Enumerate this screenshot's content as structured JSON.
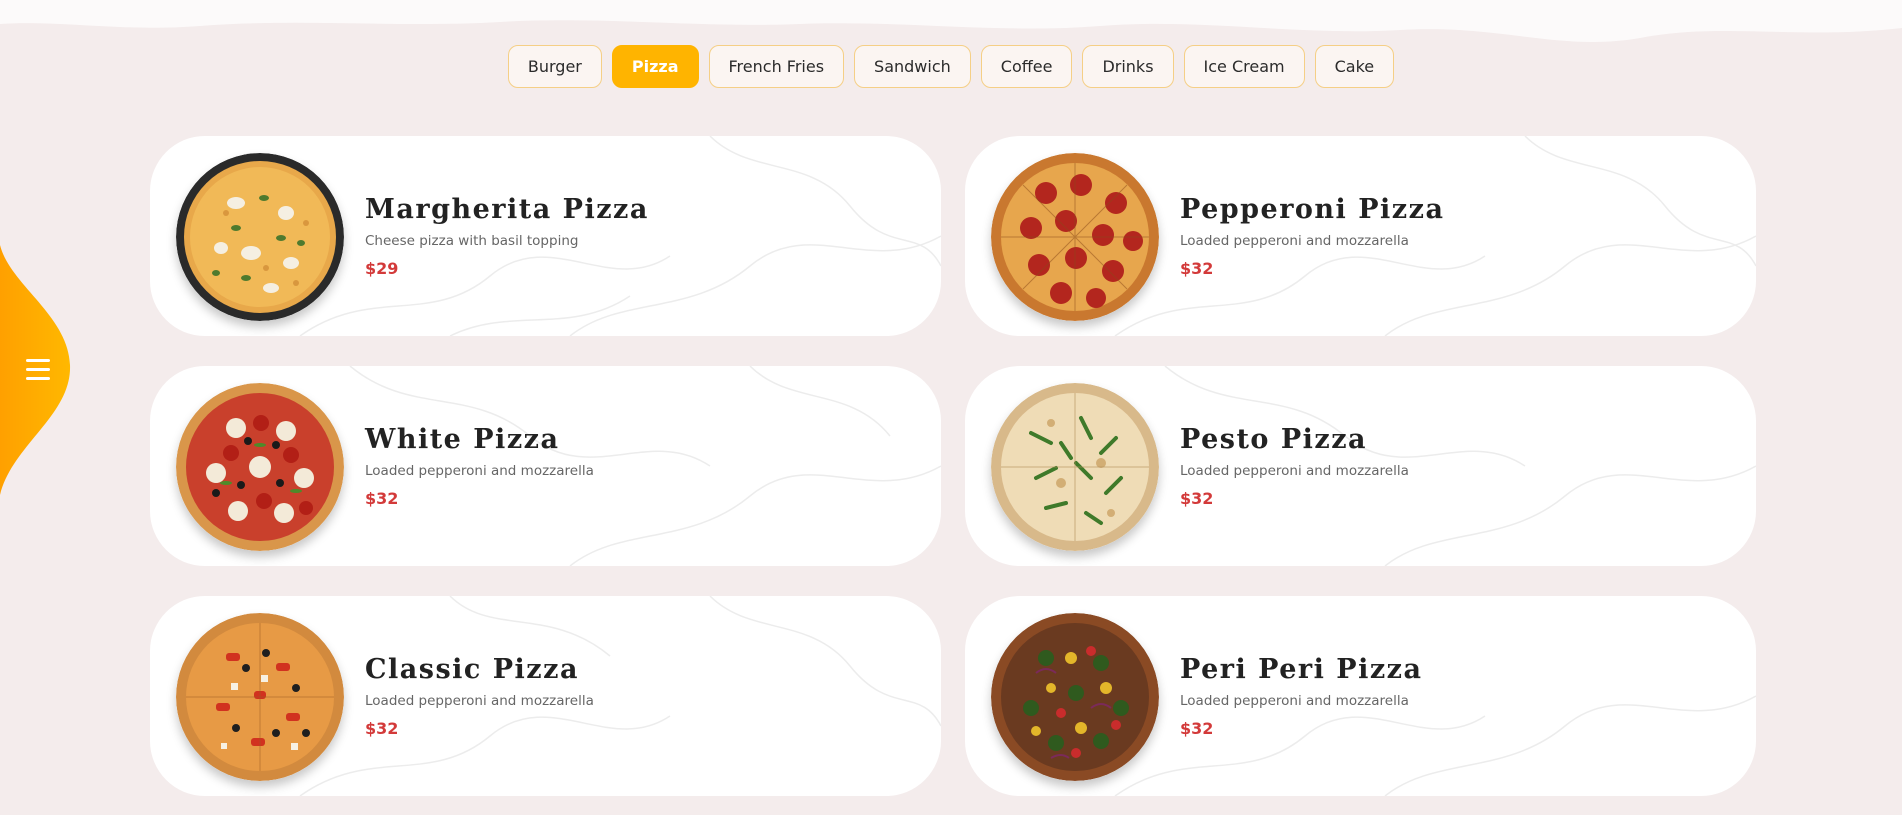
{
  "categories": [
    {
      "label": "Burger",
      "active": false
    },
    {
      "label": "Pizza",
      "active": true
    },
    {
      "label": "French Fries",
      "active": false
    },
    {
      "label": "Sandwich",
      "active": false
    },
    {
      "label": "Coffee",
      "active": false
    },
    {
      "label": "Drinks",
      "active": false
    },
    {
      "label": "Ice Cream",
      "active": false
    },
    {
      "label": "Cake",
      "active": false
    }
  ],
  "side_menu": {
    "icon": "hamburger-icon"
  },
  "colors": {
    "accent": "#ffb400",
    "price": "#d33a3a",
    "background": "#f4ecec"
  },
  "menu_items": [
    {
      "name": "Margherita Pizza",
      "description": "Cheese pizza with basil topping",
      "price": "$29",
      "image": "margherita-pizza"
    },
    {
      "name": "Pepperoni Pizza",
      "description": "Loaded pepperoni and mozzarella",
      "price": "$32",
      "image": "pepperoni-pizza"
    },
    {
      "name": "White Pizza",
      "description": "Loaded pepperoni and mozzarella",
      "price": "$32",
      "image": "white-pizza"
    },
    {
      "name": "Pesto Pizza",
      "description": "Loaded pepperoni and mozzarella",
      "price": "$32",
      "image": "pesto-pizza"
    },
    {
      "name": "Classic Pizza",
      "description": "Loaded pepperoni and mozzarella",
      "price": "$32",
      "image": "classic-pizza"
    },
    {
      "name": "Peri Peri Pizza",
      "description": "Loaded pepperoni and mozzarella",
      "price": "$32",
      "image": "peri-peri-pizza"
    }
  ]
}
